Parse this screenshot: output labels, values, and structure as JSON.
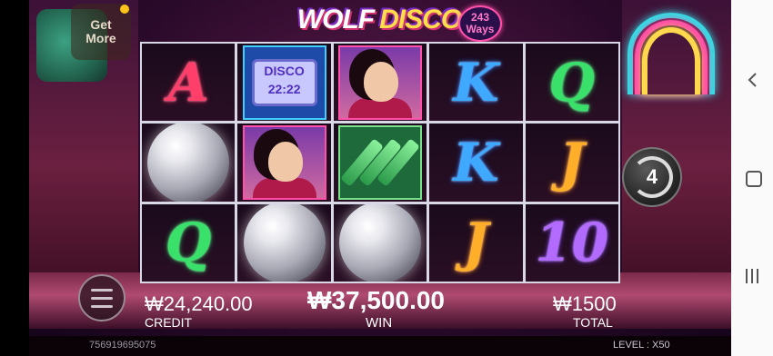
{
  "header": {
    "logo_word1": "WOLF",
    "logo_word2": "DISCO",
    "ways_number": "243",
    "ways_label": "Ways",
    "get_more_line1": "Get",
    "get_more_line2": "More"
  },
  "reels": [
    [
      "A",
      "disco-ball",
      "Q"
    ],
    [
      "disco-sign",
      "dancer",
      "disco-ball"
    ],
    [
      "dancer",
      "bottles",
      "disco-ball"
    ],
    [
      "K",
      "K",
      "J"
    ],
    [
      "Q",
      "J",
      "10"
    ]
  ],
  "disco_sign": {
    "line1": "DISCO",
    "line2": "22:22"
  },
  "spin": {
    "count": "4"
  },
  "info": {
    "credit_value": "₩24,240.00",
    "credit_label": "CREDIT",
    "win_value": "₩37,500.00",
    "win_label": "WIN",
    "total_value": "₩1500",
    "total_label": "TOTAL",
    "session_id": "756919695075",
    "level_label": "LEVEL :",
    "level_value": "X50"
  },
  "icons": {
    "menu": "hamburger-menu-icon",
    "spin": "replay-arrow-icon",
    "nav_back": "chevron-left-icon",
    "nav_home": "square-icon",
    "nav_recents": "three-bars-icon"
  },
  "colors": {
    "symbol_A": "#ff3e6a",
    "symbol_K": "#3fa8ff",
    "symbol_Q": "#39e06a",
    "symbol_J": "#ffae2a",
    "symbol_10": "#b36bff"
  }
}
